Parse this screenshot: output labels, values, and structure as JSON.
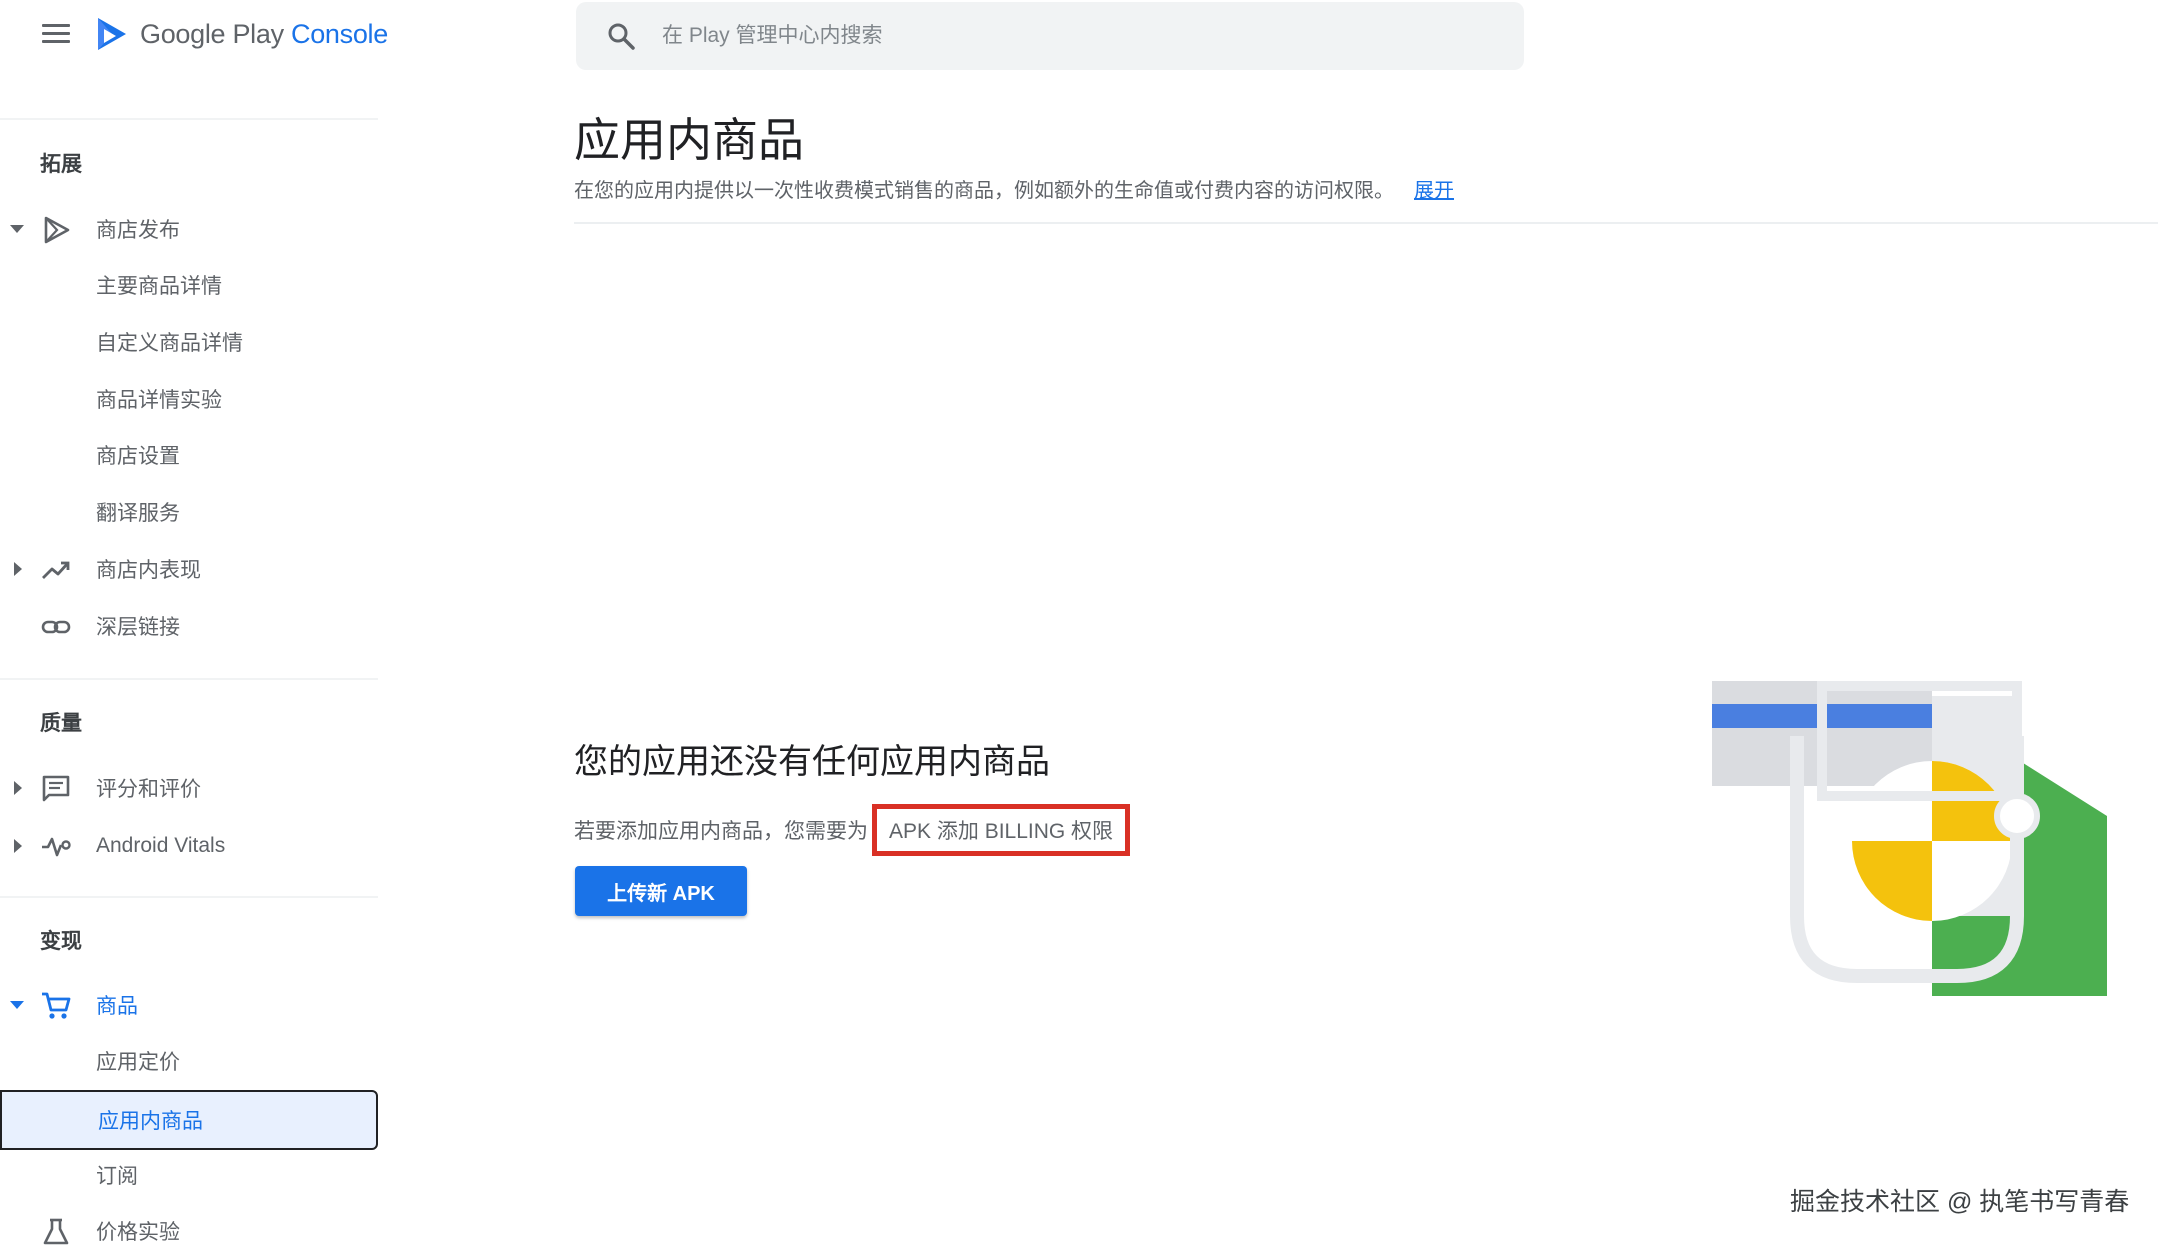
{
  "header": {
    "brand_prefix": "Google Play ",
    "brand_accent": "Console",
    "search_placeholder": "在 Play 管理中心内搜索"
  },
  "sidebar": {
    "sections": {
      "expand": "拓展",
      "quality": "质量",
      "monetize": "变现"
    },
    "items": {
      "store_presence": "商店发布",
      "main_listing": "主要商品详情",
      "custom_listing": "自定义商品详情",
      "listing_experiments": "商品详情实验",
      "store_settings": "商店设置",
      "translation": "翻译服务",
      "store_performance": "商店内表现",
      "deep_links": "深层链接",
      "ratings_reviews": "评分和评价",
      "android_vitals": "Android Vitals",
      "products": "商品",
      "app_pricing": "应用定价",
      "in_app_products": "应用内商品",
      "subscriptions": "订阅",
      "price_experiments": "价格实验"
    }
  },
  "main": {
    "title": "应用内商品",
    "description": "在您的应用内提供以一次性收费模式销售的商品，例如额外的生命值或付费内容的访问权限。",
    "expand_link": "展开",
    "empty_title": "您的应用还没有任何应用内商品",
    "empty_desc": "若要添加应用内商品，您需要为",
    "empty_highlight": "APK 添加 BILLING 权限",
    "upload_button": "上传新 APK"
  },
  "watermark": "掘金技术社区 @ 执笔书写青春",
  "colors": {
    "accent": "#1a73e8",
    "highlight_border": "#d93025",
    "illustration_yellow": "#f4c20d",
    "illustration_green": "#4caf50"
  }
}
